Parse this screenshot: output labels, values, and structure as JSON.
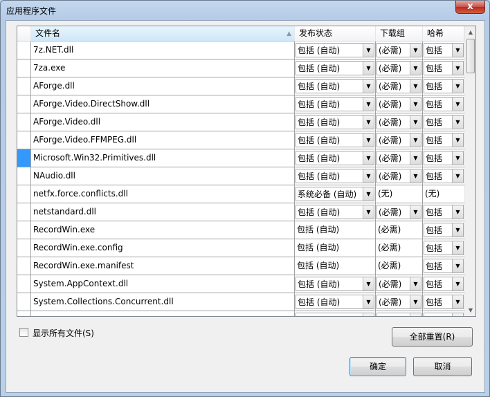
{
  "window": {
    "title": "应用程序文件",
    "close": "x"
  },
  "columns": {
    "name": "文件名",
    "status": "发布状态",
    "group": "下载组",
    "hash": "哈希"
  },
  "rows": [
    {
      "name": "7z.NET.dll",
      "status": "包括 (自动)",
      "group": "(必需)",
      "hash": "包括",
      "status_combo": true,
      "group_combo": true,
      "hash_combo": true
    },
    {
      "name": "7za.exe",
      "status": "包括 (自动)",
      "group": "(必需)",
      "hash": "包括",
      "status_combo": true,
      "group_combo": true,
      "hash_combo": true
    },
    {
      "name": "AForge.dll",
      "status": "包括 (自动)",
      "group": "(必需)",
      "hash": "包括",
      "status_combo": true,
      "group_combo": true,
      "hash_combo": true
    },
    {
      "name": "AForge.Video.DirectShow.dll",
      "status": "包括 (自动)",
      "group": "(必需)",
      "hash": "包括",
      "status_combo": true,
      "group_combo": true,
      "hash_combo": true
    },
    {
      "name": "AForge.Video.dll",
      "status": "包括 (自动)",
      "group": "(必需)",
      "hash": "包括",
      "status_combo": true,
      "group_combo": true,
      "hash_combo": true
    },
    {
      "name": "AForge.Video.FFMPEG.dll",
      "status": "包括 (自动)",
      "group": "(必需)",
      "hash": "包括",
      "status_combo": true,
      "group_combo": true,
      "hash_combo": true
    },
    {
      "name": "Microsoft.Win32.Primitives.dll",
      "status": "包括 (自动)",
      "group": "(必需)",
      "hash": "包括",
      "status_combo": true,
      "group_combo": true,
      "hash_combo": true,
      "selected": true
    },
    {
      "name": "NAudio.dll",
      "status": "包括 (自动)",
      "group": "(必需)",
      "hash": "包括",
      "status_combo": true,
      "group_combo": true,
      "hash_combo": true
    },
    {
      "name": "netfx.force.conflicts.dll",
      "status": "系统必备 (自动)",
      "group": "(无)",
      "hash": "(无)",
      "status_combo": true,
      "group_combo": false,
      "hash_combo": false
    },
    {
      "name": "netstandard.dll",
      "status": "包括 (自动)",
      "group": "(必需)",
      "hash": "包括",
      "status_combo": true,
      "group_combo": true,
      "hash_combo": true
    },
    {
      "name": "RecordWin.exe",
      "status": "包括 (自动)",
      "group": "(必需)",
      "hash": "包括",
      "status_combo": false,
      "group_combo": false,
      "hash_combo": true
    },
    {
      "name": "RecordWin.exe.config",
      "status": "包括 (自动)",
      "group": "(必需)",
      "hash": "包括",
      "status_combo": false,
      "group_combo": false,
      "hash_combo": true
    },
    {
      "name": "RecordWin.exe.manifest",
      "status": "包括 (自动)",
      "group": "(必需)",
      "hash": "包括",
      "status_combo": false,
      "group_combo": false,
      "hash_combo": true
    },
    {
      "name": "System.AppContext.dll",
      "status": "包括 (自动)",
      "group": "(必需)",
      "hash": "包括",
      "status_combo": true,
      "group_combo": true,
      "hash_combo": true
    },
    {
      "name": "System.Collections.Concurrent.dll",
      "status": "包括 (自动)",
      "group": "(必需)",
      "hash": "包括",
      "status_combo": true,
      "group_combo": true,
      "hash_combo": true
    },
    {
      "name": "",
      "status": "",
      "group": "",
      "hash": "",
      "status_combo": true,
      "group_combo": true,
      "hash_combo": true
    }
  ],
  "show_all": {
    "label": "显示所有文件(S)",
    "checked": false
  },
  "buttons": {
    "reset_all": "全部重置(R)",
    "ok": "确定",
    "cancel": "取消"
  },
  "icons": {
    "sort": "sort-ascending-icon",
    "dropdown": "chevron-down-icon",
    "scroll_up": "scroll-up-icon",
    "scroll_down": "scroll-down-icon"
  },
  "colors": {
    "selection": "#3399ff",
    "header_sorted": "#cfe7fa",
    "close_button": "#c75050"
  }
}
